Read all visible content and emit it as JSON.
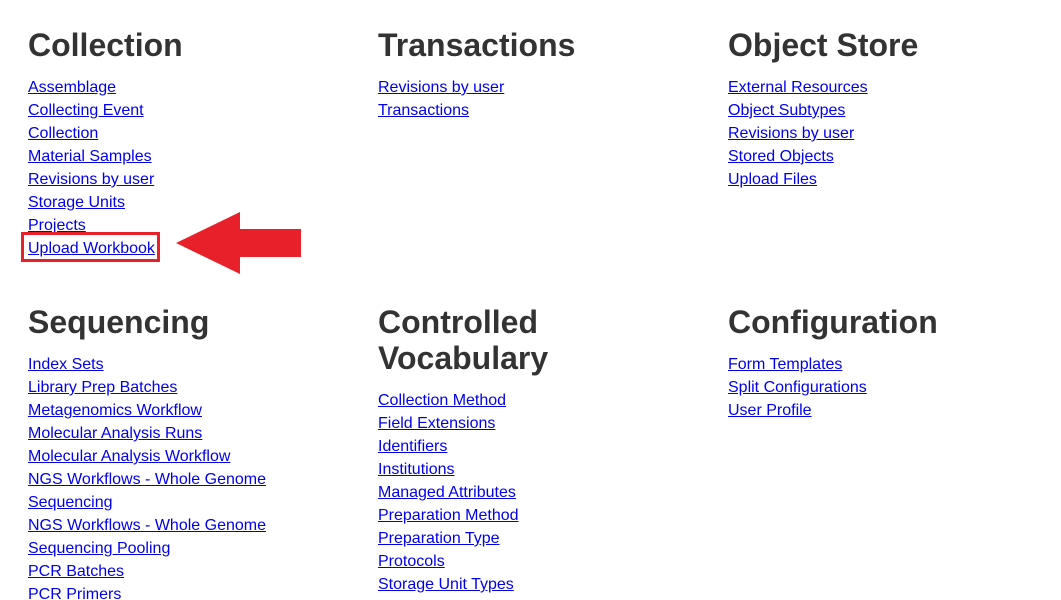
{
  "sections": {
    "collection": {
      "title": "Collection",
      "links": [
        "Assemblage",
        "Collecting Event",
        "Collection",
        "Material Samples",
        "Revisions by user",
        "Storage Units",
        "Projects",
        "Upload Workbook"
      ]
    },
    "transactions": {
      "title": "Transactions",
      "links": [
        "Revisions by user",
        "Transactions"
      ]
    },
    "object_store": {
      "title": "Object Store",
      "links": [
        "External Resources",
        "Object Subtypes",
        "Revisions by user",
        "Stored Objects",
        "Upload Files"
      ]
    },
    "sequencing": {
      "title": "Sequencing",
      "links": [
        "Index Sets",
        "Library Prep Batches",
        "Metagenomics Workflow",
        "Molecular Analysis Runs",
        "Molecular Analysis Workflow",
        "NGS Workflows - Whole Genome",
        "Sequencing",
        "NGS Workflows - Whole Genome",
        "Sequencing Pooling",
        "PCR Batches",
        "PCR Primers"
      ]
    },
    "controlled_vocabulary": {
      "title_line1": "Controlled",
      "title_line2": "Vocabulary",
      "links": [
        "Collection Method",
        "Field Extensions",
        "Identifiers",
        "Institutions",
        "Managed Attributes",
        "Preparation Method",
        "Preparation Type",
        "Protocols",
        "Storage Unit Types"
      ]
    },
    "configuration": {
      "title": "Configuration",
      "links": [
        "Form Templates",
        "Split Configurations",
        "User Profile"
      ]
    }
  },
  "annotation": {
    "highlight_color": "#e8202a",
    "arrow_icon": "left-arrow-icon"
  }
}
